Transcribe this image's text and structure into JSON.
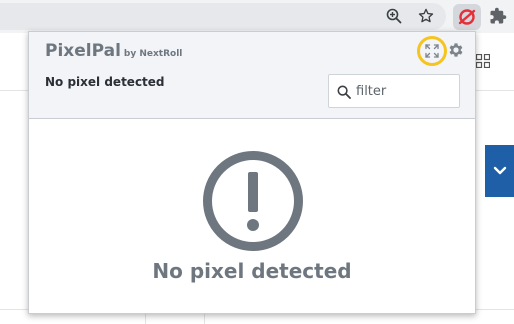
{
  "browser": {
    "icons": [
      "zoom-icon",
      "star-icon",
      "pixelpal-extension-icon",
      "puzzle-icon"
    ]
  },
  "popup": {
    "brand": {
      "name": "PixelPal",
      "byline": "by NextRoll"
    },
    "status_text": "No pixel detected",
    "filter": {
      "placeholder": "filter",
      "value": ""
    },
    "empty_state": {
      "icon": "exclamation-circle-icon",
      "title": "No pixel detected"
    }
  },
  "colors": {
    "highlight_ring": "#f6c41e",
    "brand_gray": "#6e7780",
    "extension_red": "#e5303a",
    "page_accent_blue": "#1f5fa8"
  }
}
